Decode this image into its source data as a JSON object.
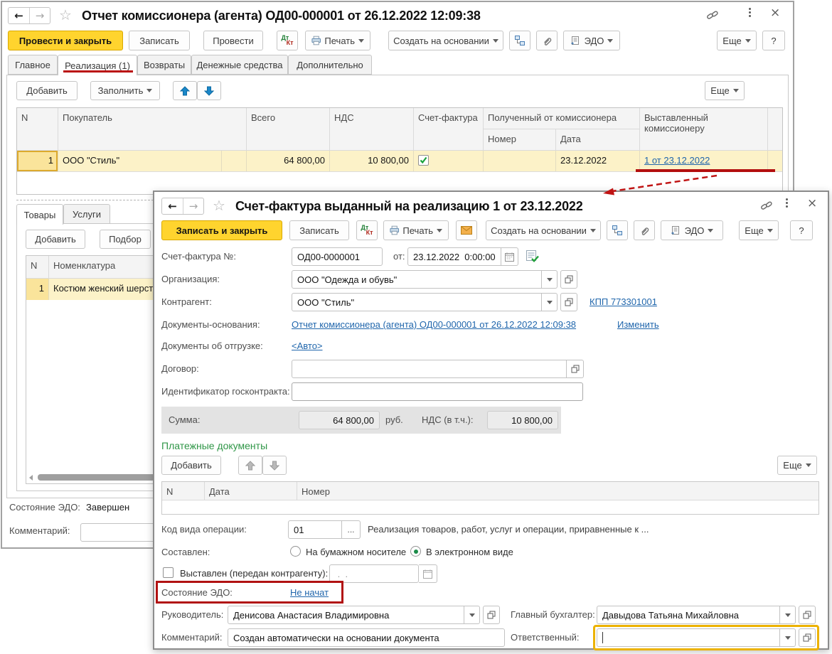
{
  "colors": {
    "accent_yellow": "#ffd42e",
    "link_blue": "#2066ac",
    "annotation_red": "#bb1111",
    "green_header": "#2f9647",
    "focus_ring": "#ecb200"
  },
  "window1": {
    "title": "Отчет комиссионера (агента) ОД00-000001 от 26.12.2022 12:09:38",
    "toolbar": {
      "post_and_close": "Провести и закрыть",
      "save": "Записать",
      "post": "Провести",
      "dtkt_dt": "Дт",
      "dtkt_kt": "Кт",
      "print": "Печать",
      "create_based_on": "Создать на основании",
      "edo": "ЭДО",
      "more": "Еще",
      "help": "?"
    },
    "tabs": [
      {
        "label": "Главное"
      },
      {
        "label": "Реализация (1)"
      },
      {
        "label": "Возвраты"
      },
      {
        "label": "Денежные средства"
      },
      {
        "label": "Дополнительно"
      }
    ],
    "list_toolbar": {
      "add": "Добавить",
      "fill": "Заполнить",
      "more": "Еще"
    },
    "table": {
      "col_n": "N",
      "col_buyer": "Покупатель",
      "col_total": "Всего",
      "col_vat": "НДС",
      "col_invoice": "Счет-фактура",
      "col_received": "Полученный от комиссионера",
      "col_number": "Номер",
      "col_date": "Дата",
      "col_issued": "Выставленный комиссионеру",
      "row": {
        "n": "1",
        "buyer": "ООО \"Стиль\"",
        "total": "64 800,00",
        "vat": "10 800,00",
        "number": "",
        "date": "23.12.2022",
        "issued": "1 от 23.12.2022"
      }
    },
    "goods_tabs": {
      "goods": "Товары",
      "services": "Услуги"
    },
    "goods_toolbar": {
      "add": "Добавить",
      "pick": "Подбор"
    },
    "goods_table": {
      "col_n": "N",
      "col_nomenclature": "Номенклатура",
      "row": {
        "n": "1",
        "nomenclature": "Костюм женский шерст"
      }
    },
    "edo_status_label": "Состояние ЭДО:",
    "edo_status_value": "Завершен",
    "comment_label": "Комментарий:"
  },
  "window2": {
    "title": "Счет-фактура выданный на реализацию 1 от 23.12.2022",
    "toolbar": {
      "save_and_close": "Записать и закрыть",
      "save": "Записать",
      "dtkt_dt": "Дт",
      "dtkt_kt": "Кт",
      "print": "Печать",
      "create_based_on": "Создать на основании",
      "edo": "ЭДО",
      "more": "Еще",
      "help": "?"
    },
    "fields": {
      "number_label": "Счет-фактура №:",
      "number_value": "ОД00-0000001",
      "from_label": "от:",
      "date_value": "23.12.2022  0:00:00",
      "org_label": "Организация:",
      "org_value": "ООО \"Одежда и обувь\"",
      "contractor_label": "Контрагент:",
      "contractor_value": "ООО \"Стиль\"",
      "kpp_link": "КПП 773301001",
      "basis_label": "Документы-основания:",
      "basis_link": "Отчет комиссионера (агента) ОД00-000001 от 26.12.2022 12:09:38",
      "change_link": "Изменить",
      "shipment_label": "Документы об отгрузке:",
      "shipment_link": "<Авто>",
      "contract_label": "Договор:",
      "gov_contract_label": "Идентификатор госконтракта:",
      "sum_label": "Сумма:",
      "sum_value": "64 800,00",
      "currency": "руб.",
      "vat_label": "НДС (в т.ч.):",
      "vat_value": "10 800,00"
    },
    "payments": {
      "header": "Платежные документы",
      "add": "Добавить",
      "more": "Еще",
      "col_n": "N",
      "col_date": "Дата",
      "col_number": "Номер"
    },
    "operation": {
      "label": "Код вида операции:",
      "code": "01",
      "dots": "...",
      "description": "Реализация товаров, работ, услуг и операции, приравненные к ..."
    },
    "composed": {
      "label": "Составлен:",
      "paper": "На бумажном носителе",
      "electronic": "В электронном виде"
    },
    "issued": {
      "label": "Выставлен (передан контрагенту):",
      "date_placeholder": " .  . "
    },
    "edo_state": {
      "label": "Состояние ЭДО:",
      "value": "Не начат"
    },
    "head": {
      "label": "Руководитель:",
      "value": "Денисова Анастасия Владимировна"
    },
    "accountant": {
      "label": "Главный бухгалтер:",
      "value": "Давыдова Татьяна Михайловна"
    },
    "comment": {
      "label": "Комментарий:",
      "value": "Создан автоматически на основании документа"
    },
    "responsible": {
      "label": "Ответственный:",
      "value": ""
    }
  }
}
